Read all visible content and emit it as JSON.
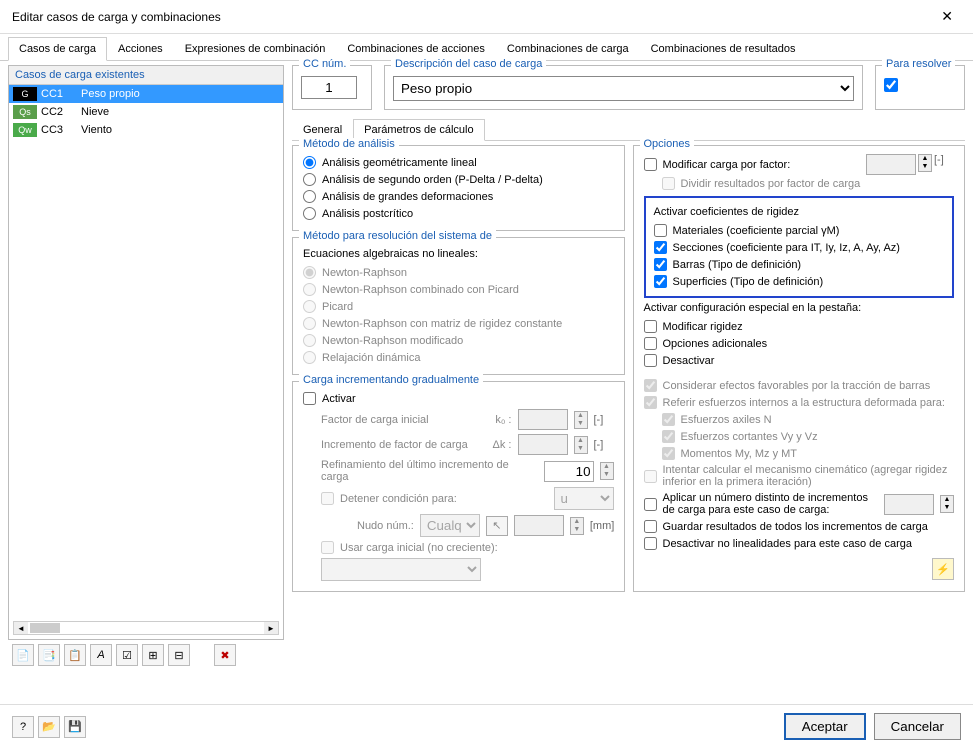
{
  "window": {
    "title": "Editar casos de carga y combinaciones"
  },
  "mainTabs": [
    "Casos de carga",
    "Acciones",
    "Expresiones de combinación",
    "Combinaciones de acciones",
    "Combinaciones de carga",
    "Combinaciones de resultados"
  ],
  "mainTabActive": 0,
  "casesHeader": "Casos de carga existentes",
  "cases": [
    {
      "tag": "G",
      "id": "CC1",
      "name": "Peso propio",
      "sel": true
    },
    {
      "tag": "Qs",
      "id": "CC2",
      "name": "Nieve",
      "sel": false
    },
    {
      "tag": "Qw",
      "id": "CC3",
      "name": "Viento",
      "sel": false
    }
  ],
  "ccNum": {
    "label": "CC núm.",
    "value": "1"
  },
  "desc": {
    "label": "Descripción del caso de carga",
    "value": "Peso propio"
  },
  "solve": {
    "label": "Para resolver",
    "checked": true
  },
  "subTabs": [
    "General",
    "Parámetros de cálculo"
  ],
  "subTabActive": 1,
  "analysis": {
    "legend": "Método de análisis",
    "items": [
      "Análisis geométricamente lineal",
      "Análisis de segundo orden (P-Delta / P-delta)",
      "Análisis de grandes deformaciones",
      "Análisis postcrítico"
    ],
    "selected": 0
  },
  "solver": {
    "legend": "Método para resolución del sistema de",
    "sub": "Ecuaciones algebraicas no lineales:",
    "items": [
      "Newton-Raphson",
      "Newton-Raphson combinado con Picard",
      "Picard",
      "Newton-Raphson con matriz de rigidez constante",
      "Newton-Raphson modificado",
      "Relajación dinámica"
    ],
    "selected": 0
  },
  "incremental": {
    "legend": "Carga incrementando gradualmente",
    "activate": "Activar",
    "k0": {
      "label": "Factor de carga inicial",
      "sym": "k₀ :",
      "unit": "[-]"
    },
    "dk": {
      "label": "Incremento de factor de carga",
      "sym": "Δk :",
      "unit": "[-]"
    },
    "refine": {
      "label": "Refinamiento del último incremento de carga",
      "value": "10"
    },
    "stop": {
      "label": "Detener condición para:",
      "sel": "u"
    },
    "node": {
      "label": "Nudo núm.:",
      "sel": "Cualqui",
      "unit": "[mm]"
    },
    "initial": "Usar carga inicial (no creciente):"
  },
  "options": {
    "legend": "Opciones",
    "modFactor": "Modificar carga por factor:",
    "modFactorUnit": "[-]",
    "divide": "Dividir resultados por factor de carga",
    "stiffTitle": "Activar coeficientes de rigidez",
    "stiff": {
      "mat": "Materiales (coeficiente parcial γM)",
      "sec": "Secciones (coeficiente para IT, Iy, Iz, A, Ay, Az)",
      "bar": "Barras (Tipo de definición)",
      "surf": "Superficies (Tipo de definición)"
    },
    "specialTitle": "Activar configuración especial en la pestaña:",
    "sp1": "Modificar rigidez",
    "sp2": "Opciones adicionales",
    "sp3": "Desactivar",
    "fav": "Considerar efectos favorables por la tracción de barras",
    "refer": "Referir esfuerzos internos a la estructura deformada para:",
    "ref1": "Esfuerzos axiles N",
    "ref2": "Esfuerzos cortantes Vy y Vz",
    "ref3": "Momentos My, Mz y MT",
    "kinem": "Intentar calcular el mecanismo cinemático (agregar rigidez inferior en la primera iteración)",
    "apply": "Aplicar un número distinto de incrementos de carga para este caso de carga:",
    "save": "Guardar resultados de todos los incrementos de carga",
    "deact": "Desactivar no linealidades para este caso de carga"
  },
  "footer": {
    "ok": "Aceptar",
    "cancel": "Cancelar"
  }
}
